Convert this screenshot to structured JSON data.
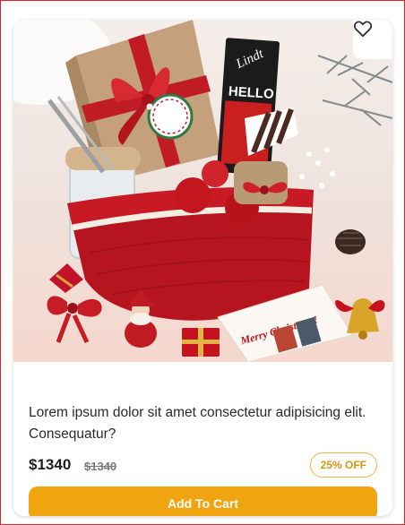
{
  "product": {
    "title": "Lorem ipsum dolor sit amet consectetur adipisicing elit. Consequatur?",
    "price": "$1340",
    "original_price": "$1340",
    "discount_badge": "25% OFF",
    "add_to_cart_label": "Add To Cart",
    "image_alt": "Christmas gift basket",
    "wishlist_icon": "heart-outline-icon"
  },
  "image_text": {
    "chocolate_brand": "Lindt",
    "chocolate_name": "HELLO",
    "card_text": "Merry Christmas!"
  },
  "colors": {
    "accent": "#f0a410",
    "badge_text": "#d99412",
    "badge_border": "#e8b54a",
    "page_border": "#d9262b"
  }
}
